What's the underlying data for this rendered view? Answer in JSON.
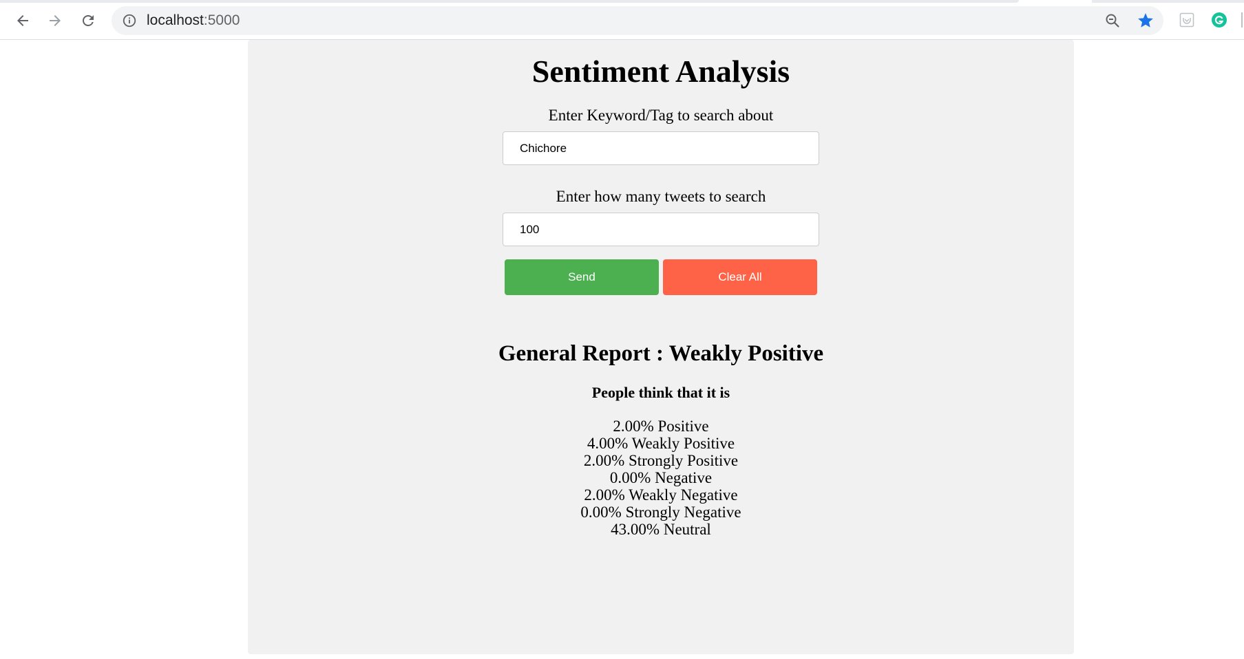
{
  "browser": {
    "url_host": "localhost",
    "url_port": ":5000",
    "icons": {
      "back": "arrow-left-icon",
      "forward": "arrow-right-icon",
      "reload": "reload-icon",
      "site_info": "info-icon",
      "zoom": "zoom-out-icon",
      "bookmark": "star-icon",
      "pocket": "pocket-extension-icon",
      "grammarly": "grammarly-extension-icon"
    },
    "colors": {
      "star": "#1a73e8",
      "grammarly": "#15c39a"
    }
  },
  "page": {
    "title": "Sentiment Analysis",
    "keyword_label": "Enter Keyword/Tag to search about",
    "keyword_value": "Chichore",
    "count_label": "Enter how many tweets to search",
    "count_value": "100",
    "send_label": "Send",
    "clear_label": "Clear All",
    "colors": {
      "send": "#4caf50",
      "clear": "#ff6347",
      "panel": "#f1f1f1"
    }
  },
  "report": {
    "title": "General Report : Weakly Positive",
    "subtitle": "People think that it is",
    "stats": [
      "2.00% Positive",
      "4.00% Weakly Positive",
      "2.00% Strongly Positive",
      "0.00% Negative",
      "2.00% Weakly Negative",
      "0.00% Strongly Negative",
      "43.00% Neutral"
    ]
  }
}
